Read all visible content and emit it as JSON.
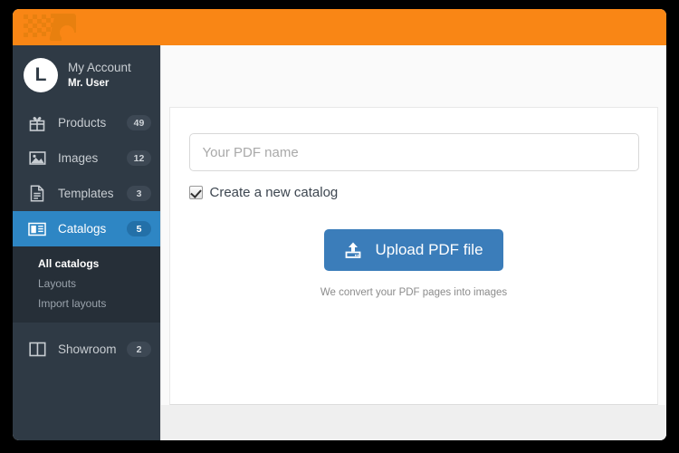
{
  "window": {
    "background_color": "#000000",
    "header_color": "#f98615",
    "sidebar_color": "#2f3a45",
    "accent_color": "#2e86c4",
    "button_color": "#3b7dba"
  },
  "header": {
    "logo_name": "checkered-flag-logo"
  },
  "sidebar": {
    "account": {
      "avatar_letter": "L",
      "name": "My Account",
      "user": "Mr. User"
    },
    "items": [
      {
        "label": "Products",
        "badge": "49",
        "icon": "gift-icon",
        "active": false
      },
      {
        "label": "Images",
        "badge": "12",
        "icon": "image-icon",
        "active": false
      },
      {
        "label": "Templates",
        "badge": "3",
        "icon": "document-icon",
        "active": false
      },
      {
        "label": "Catalogs",
        "badge": "5",
        "icon": "catalog-icon",
        "active": true
      },
      {
        "label": "Showroom",
        "badge": "2",
        "icon": "columns-icon",
        "active": false
      }
    ],
    "submenu": [
      {
        "label": "All catalogs",
        "current": true
      },
      {
        "label": "Layouts",
        "current": false
      },
      {
        "label": "Import layouts",
        "current": false
      }
    ]
  },
  "main": {
    "pdf_name": {
      "value": "",
      "placeholder": "Your PDF name"
    },
    "checkbox": {
      "label": "Create a new catalog",
      "checked": true
    },
    "upload_button": {
      "label": "Upload PDF file",
      "icon": "upload-icon"
    },
    "helper_text": "We convert your PDF pages into images"
  }
}
